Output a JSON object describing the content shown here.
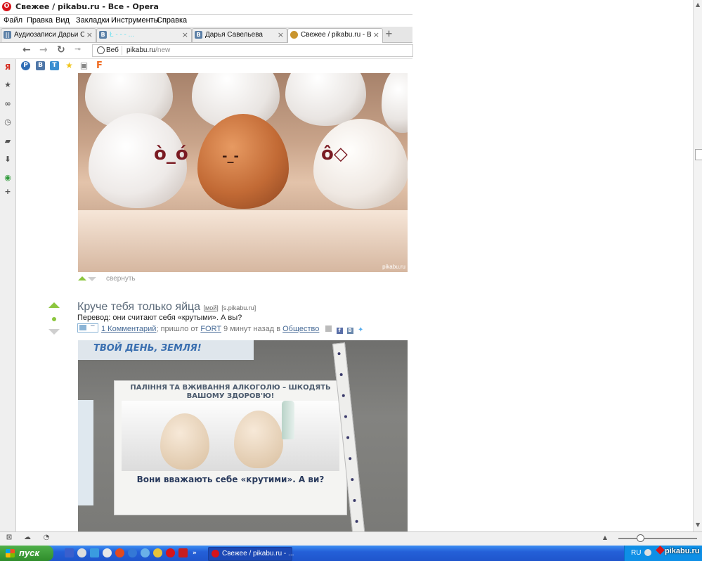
{
  "window": {
    "title": "Свежее / pikabu.ru - Все - Opera",
    "logo_icon": "opera-logo-icon"
  },
  "menu": [
    "Файл",
    "Правка",
    "Вид",
    "Закладки",
    "Инструменты",
    "Справка"
  ],
  "tabs": [
    {
      "label": "Аудиозаписи Дарьи Са...",
      "icon": "vk-audio-icon",
      "color": "#5b7fa6",
      "active": false
    },
    {
      "label": "Ł - - - ...",
      "icon": "vk-icon",
      "color": "#5b7fa6",
      "active": false
    },
    {
      "label": "Дарья Савельева",
      "icon": "vk-icon",
      "color": "#5b7fa6",
      "active": false
    },
    {
      "label": "Свежее / pikabu.ru - Все",
      "icon": "pikabu-icon",
      "color": "#c9952e",
      "active": true
    }
  ],
  "address": {
    "badge": "Веб",
    "domain": "pikabu.ru",
    "path": "/new"
  },
  "bookmarks": [
    {
      "icon": "p-icon",
      "glyph": "P",
      "color": "#2f6db5"
    },
    {
      "icon": "vk-icon",
      "glyph": "В",
      "color": "#4f77a8"
    },
    {
      "icon": "t-icon",
      "glyph": "T",
      "color": "#3b8fd1"
    },
    {
      "icon": "star-icon",
      "glyph": "★",
      "color": "#f0c419"
    },
    {
      "icon": "screenshot-icon",
      "glyph": "▣",
      "color": "#888888"
    },
    {
      "icon": "f-icon",
      "glyph": "F",
      "color": "#f06a1e"
    }
  ],
  "post1": {
    "image_watermark": "pikabu.ru",
    "collapse_label": "свернуть"
  },
  "post2": {
    "title": "Круче тебя только яйца",
    "tag_mine": "мой",
    "tag_short": "s.pikabu.ru",
    "subtitle": "Перевод: они считают себя «крутыми». А вы?",
    "comments_link": "1 Комментарий",
    "meta_middle": "; пришло от",
    "author": "FORT",
    "time": "9 минут назад в",
    "category": "Общество",
    "poster_heading": "ПАЛІННЯ ТА ВЖИВАННЯ АЛКОГОЛЮ – ШКОДЯТЬ ВАШОМУ ЗДОРОВ'Ю!",
    "poster_caption": "Вони вважають себе «крутими». А ви?",
    "newspaper_headline": "ТВОЙ ДЕНЬ, ЗЕМЛЯ!"
  },
  "taskbar": {
    "start_label": "пуск",
    "item_label": "Свежее / pikabu.ru - ...",
    "lang": "RU",
    "tray_brand": "pikabu.ru"
  },
  "colors": {
    "vote_up": "#8cc63e",
    "link": "#4a6d98",
    "title": "#5b6a79",
    "taskbar": "#2460d8"
  }
}
